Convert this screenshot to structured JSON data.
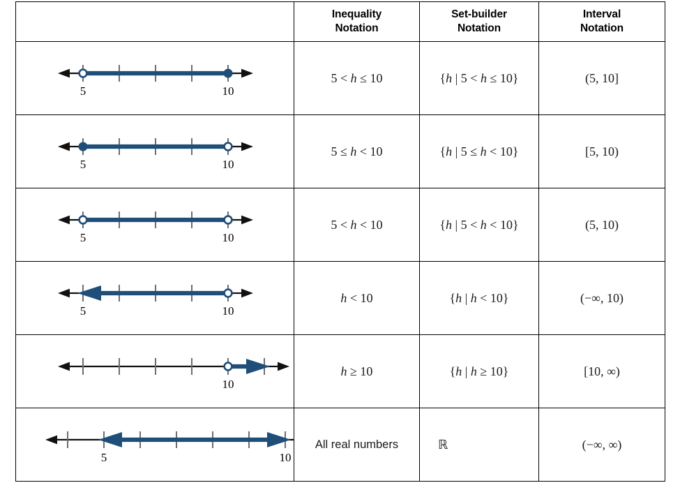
{
  "table": {
    "header": {
      "col_numberline": "",
      "col_inequality": "Inequality\nNotation",
      "col_inequality_line1": "Inequality",
      "col_inequality_line2": "Notation",
      "col_setbuilder_line1": "Set-builder",
      "col_setbuilder_line2": "Notation",
      "col_interval_line1": "Interval",
      "col_interval_line2": "Notation"
    },
    "rows": [
      {
        "id": "row-1",
        "inequality": "5 < h ≤ 10",
        "inequality_parts": {
          "left": "5 < ",
          "var": "h",
          "right": " ≤ 10"
        },
        "setbuilder": "{h | 5 < h ≤ 10}",
        "interval": "(5, 10]",
        "number_line": {
          "type": "segment",
          "axis_arrows": [
            "left",
            "right"
          ],
          "ticks": 5,
          "labels": [
            {
              "text": "5",
              "tick": 1
            },
            {
              "text": "10",
              "tick": 5
            }
          ],
          "left_endpoint": {
            "at_tick": 1,
            "marker": "open-circle"
          },
          "right_endpoint": {
            "at_tick": 5,
            "marker": "closed-circle"
          },
          "shade_color": "#1f4e79"
        }
      },
      {
        "id": "row-2",
        "inequality": "5 ≤ h < 10",
        "inequality_parts": {
          "left": "5 ≤ ",
          "var": "h",
          "right": " < 10"
        },
        "setbuilder": "{h | 5 ≤ h < 10}",
        "interval": "[5, 10)",
        "number_line": {
          "type": "segment",
          "axis_arrows": [
            "left",
            "right"
          ],
          "ticks": 5,
          "labels": [
            {
              "text": "5",
              "tick": 1
            },
            {
              "text": "10",
              "tick": 5
            }
          ],
          "left_endpoint": {
            "at_tick": 1,
            "marker": "closed-circle"
          },
          "right_endpoint": {
            "at_tick": 5,
            "marker": "open-circle"
          },
          "shade_color": "#1f4e79"
        }
      },
      {
        "id": "row-3",
        "inequality": "5 < h < 10",
        "inequality_parts": {
          "left": "5 < ",
          "var": "h",
          "right": " < 10"
        },
        "setbuilder": "{h | 5 < h < 10}",
        "interval": "(5, 10)",
        "number_line": {
          "type": "segment",
          "axis_arrows": [
            "left",
            "right"
          ],
          "ticks": 5,
          "labels": [
            {
              "text": "5",
              "tick": 1
            },
            {
              "text": "10",
              "tick": 5
            }
          ],
          "left_endpoint": {
            "at_tick": 1,
            "marker": "open-circle"
          },
          "right_endpoint": {
            "at_tick": 5,
            "marker": "open-circle"
          },
          "shade_color": "#1f4e79"
        }
      },
      {
        "id": "row-4",
        "inequality": "h < 10",
        "inequality_parts": {
          "left": "",
          "var": "h",
          "right": " < 10"
        },
        "setbuilder": "{h | h < 10}",
        "interval": "(−∞, 10)",
        "number_line": {
          "type": "ray-left",
          "axis_arrows": [
            "left",
            "right"
          ],
          "ticks": 5,
          "labels": [
            {
              "text": "5",
              "tick": 1
            },
            {
              "text": "10",
              "tick": 5
            }
          ],
          "left_endpoint": {
            "at_tick": 1,
            "marker": "blue-arrow-left"
          },
          "right_endpoint": {
            "at_tick": 5,
            "marker": "open-circle"
          },
          "shade_color": "#1f4e79"
        }
      },
      {
        "id": "row-5",
        "inequality": "h ≥ 10",
        "inequality_parts": {
          "left": "",
          "var": "h",
          "right": " ≥ 10"
        },
        "setbuilder": "{h | h ≥ 10}",
        "interval": "[10, ∞)",
        "number_line": {
          "type": "ray-right",
          "axis_arrows": [
            "left",
            "right"
          ],
          "ticks": 6,
          "labels": [
            {
              "text": "10",
              "tick": 5
            }
          ],
          "left_endpoint": {
            "at_tick": 5,
            "marker": "open-circle"
          },
          "right_endpoint": {
            "at_tick": 6,
            "marker": "blue-arrow-right"
          },
          "shade_color": "#1f4e79"
        }
      },
      {
        "id": "row-6",
        "inequality": "All real numbers",
        "inequality_parts": {
          "left": "All real numbers",
          "var": "",
          "right": ""
        },
        "setbuilder": "ℝ",
        "interval": "(−∞, ∞)",
        "number_line": {
          "type": "all-reals",
          "axis_arrows": [
            "left",
            "right"
          ],
          "ticks": 7,
          "labels": [
            {
              "text": "5",
              "tick": 2
            },
            {
              "text": "10",
              "tick": 7
            }
          ],
          "left_endpoint": {
            "at_tick": 2,
            "marker": "blue-arrow-left"
          },
          "right_endpoint": {
            "at_tick": 7,
            "marker": "blue-arrow-right"
          },
          "shade_color": "#1f4e79"
        }
      }
    ]
  },
  "colors": {
    "shade": "#1f4e79",
    "axis": "#111111",
    "tick": "#6d6d6d",
    "border": "#000000",
    "text": "#1a1a1a",
    "circle_fill": "#ffffff"
  }
}
